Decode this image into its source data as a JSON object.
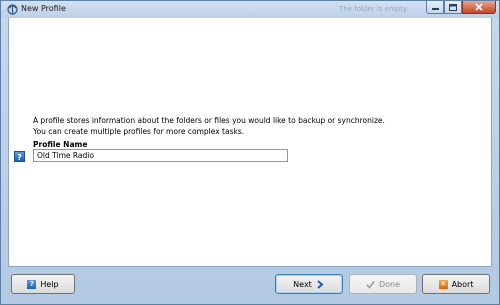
{
  "window": {
    "title": "New Profile",
    "background_ghost_texts": [
      "The folder is empty"
    ],
    "accent": "#3c7fb1"
  },
  "main": {
    "description_line1": "A profile stores information about the folders or files you would like to backup or synchronize.",
    "description_line2": "You can create multiple profiles for more complex tasks.",
    "profile_name_label": "Profile Name",
    "profile_name_value": "Old Time Radio"
  },
  "buttons": {
    "help": "Help",
    "next": "Next",
    "done": "Done",
    "abort": "Abort"
  },
  "icons": {
    "help": "question-icon",
    "next": "arrow-right-icon",
    "done": "checkmark-icon",
    "abort": "x-icon"
  }
}
